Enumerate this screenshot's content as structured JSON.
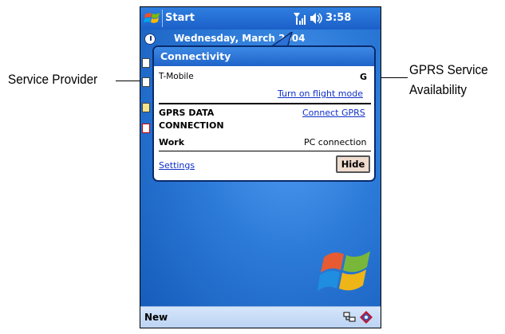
{
  "titlebar": {
    "start_label": "Start",
    "clock": "3:58"
  },
  "today": {
    "date_text": "Wednesday, March        2004"
  },
  "connectivity": {
    "title": "Connectivity",
    "provider": "T-Mobile",
    "network_indicator": "G",
    "flight_mode_link": "Turn on flight mode",
    "gprs_label_line1": "GPRS DATA",
    "gprs_label_line2": "CONNECTION",
    "connect_link": "Connect GPRS",
    "work_label": "Work",
    "work_value": "PC connection",
    "settings_link": "Settings",
    "hide_button": "Hide"
  },
  "bottombar": {
    "new_label": "New"
  },
  "callouts": {
    "left": "Service Provider",
    "right_line1": "GPRS Service",
    "right_line2": "Availability"
  },
  "colors": {
    "titlebar": "#1b5fc8",
    "link": "#1030c8",
    "hide_button_bg": "#efdccf"
  }
}
